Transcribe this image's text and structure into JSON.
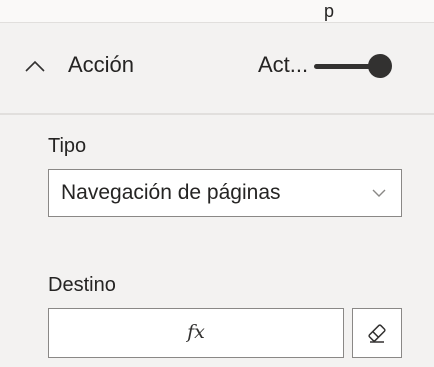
{
  "top_strip": {
    "glyph": "p"
  },
  "action_section": {
    "title": "Acción",
    "toggle_label": "Act...",
    "toggle_on": true,
    "icons": {
      "collapse": "chevron-up-icon",
      "eraser": "eraser-icon"
    }
  },
  "type_field": {
    "label": "Tipo",
    "selected_value": "Navegación de páginas"
  },
  "destination_field": {
    "label": "Destino",
    "fx_symbol": "fx"
  },
  "colors": {
    "panel_background": "#f3f2f1",
    "input_background": "#ffffff",
    "border": "#8a8886",
    "toggle": "#323130",
    "text": "#252423"
  }
}
